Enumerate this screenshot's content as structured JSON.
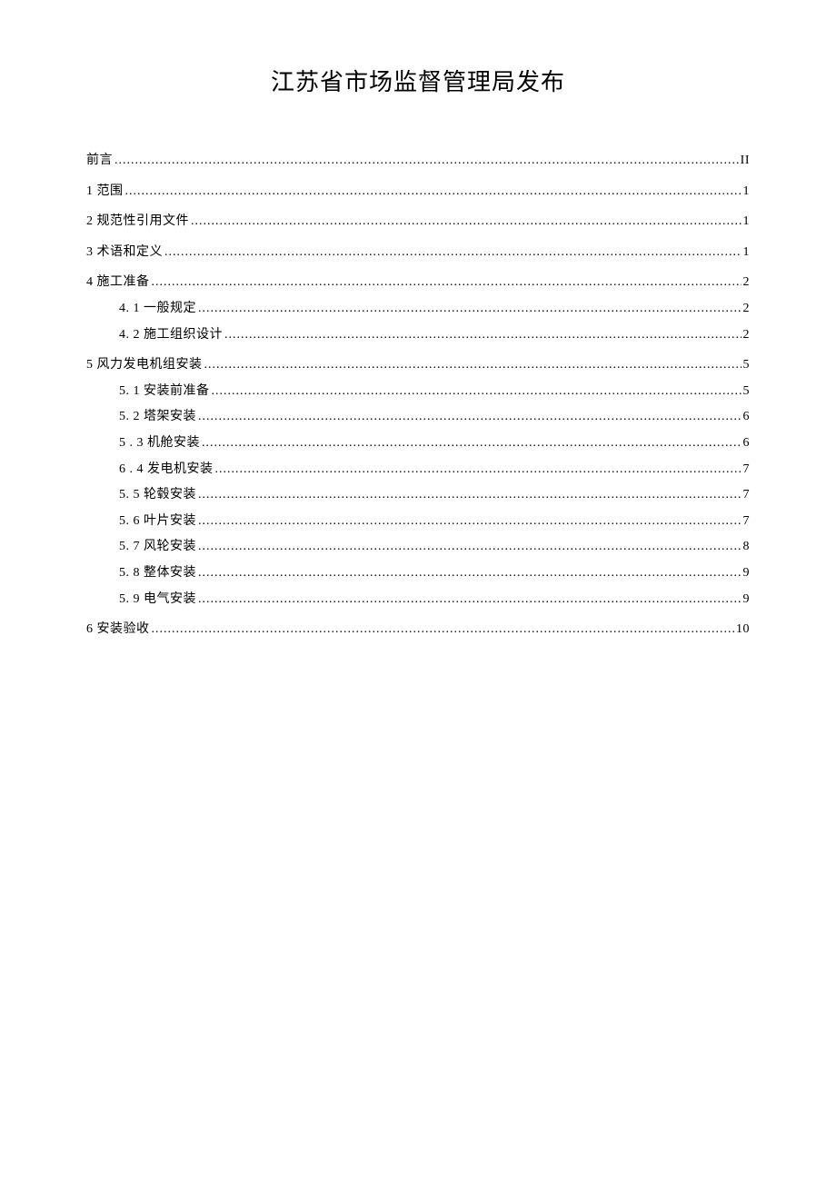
{
  "title": "江苏省市场监督管理局发布",
  "toc": [
    {
      "level": 1,
      "label": "前言",
      "page": "II"
    },
    {
      "level": 1,
      "label": "1 范围",
      "page": "1"
    },
    {
      "level": 1,
      "label": "2 规范性引用文件",
      "page": "1"
    },
    {
      "level": 1,
      "label": "3 术语和定义",
      "page": "1"
    },
    {
      "level": 1,
      "label": "4 施工准备",
      "page": "2"
    },
    {
      "level": 2,
      "label": "4.  1 一般规定",
      "page": "2"
    },
    {
      "level": 2,
      "label": "4.  2 施工组织设计",
      "page": "2"
    },
    {
      "level": 1,
      "label": "5 风力发电机组安装",
      "page": "5"
    },
    {
      "level": 2,
      "label": "5.  1 安装前准备",
      "page": "5"
    },
    {
      "level": 2,
      "label": "5.  2 塔架安装",
      "page": "6"
    },
    {
      "level": 2,
      "label": "5  . 3 机舱安装",
      "page": "6"
    },
    {
      "level": 2,
      "label": "6  . 4 发电机安装",
      "page": "7"
    },
    {
      "level": 2,
      "label": "5.  5 轮毂安装",
      "page": "7"
    },
    {
      "level": 2,
      "label": "5. 6 叶片安装",
      "page": "7"
    },
    {
      "level": 2,
      "label": "5.  7 风轮安装",
      "page": "8"
    },
    {
      "level": 2,
      "label": "5. 8   整体安装",
      "page": "9"
    },
    {
      "level": 2,
      "label": "5. 9   电气安装",
      "page": "9"
    },
    {
      "level": 1,
      "label": "6 安装验收",
      "page": "10"
    }
  ]
}
